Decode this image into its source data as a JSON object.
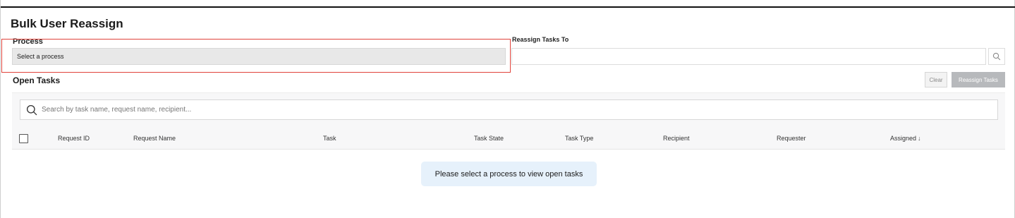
{
  "page": {
    "title": "Bulk User Reassign"
  },
  "process": {
    "label": "Process",
    "selected": "Select a process"
  },
  "reassign": {
    "label": "Reassign Tasks To",
    "value": "",
    "search_icon": "search-icon"
  },
  "open_tasks": {
    "title": "Open Tasks",
    "clear_label": "Clear",
    "reassign_label": "Reassign Tasks",
    "search_placeholder": "Search by task name, request name, recipient...",
    "search_icon": "search-icon"
  },
  "table": {
    "columns": {
      "request_id": "Request ID",
      "request_name": "Request Name",
      "task": "Task",
      "task_state": "Task State",
      "task_type": "Task Type",
      "recipient": "Recipient",
      "requester": "Requester",
      "assigned": "Assigned"
    },
    "sort_column": "Assigned",
    "sort_direction": "descending",
    "sort_arrow": "↓",
    "rows": []
  },
  "empty_state": {
    "message": "Please select a process to view open tasks"
  },
  "colors": {
    "highlight": "#e0433b",
    "empty_message_bg": "#e6f1fb",
    "disabled_button_bg": "#b7b9bc"
  }
}
